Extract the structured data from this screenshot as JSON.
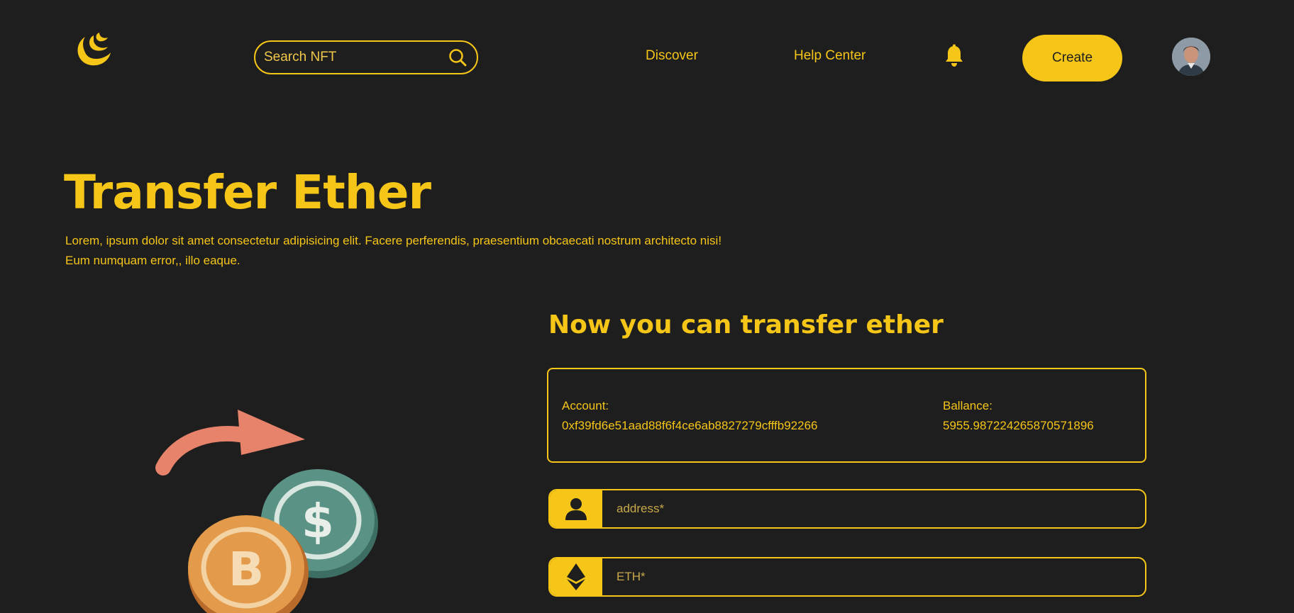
{
  "colors": {
    "background": "#1e1e1e",
    "accent": "#f5c518",
    "arrow": "#e6836a",
    "coin_green": "#4f8a7a",
    "coin_orange": "#e39a4a"
  },
  "header": {
    "logo_icon": "crescent-logo-icon",
    "search": {
      "placeholder": "Search NFT",
      "icon": "search-icon"
    },
    "nav": {
      "discover": "Discover",
      "help_center": "Help Center"
    },
    "notification_icon": "bell-icon",
    "create_label": "Create",
    "avatar_icon": "user-avatar"
  },
  "hero": {
    "title": "Transfer Ether",
    "description": "Lorem, ipsum dolor sit amet consectetur adipisicing elit. Facere perferendis, praesentium obcaecati nostrum architecto nisi! Eum numquam error,, illo eaque."
  },
  "transfer": {
    "heading": "Now you can transfer ether",
    "account_label": "Account:",
    "account_value": "0xf39fd6e51aad88f6f4ce6ab8827279cfffb92266",
    "balance_label": "Ballance:",
    "balance_value": "5955.987224265870571896",
    "address_placeholder": "address*",
    "address_icon": "user-icon",
    "eth_placeholder": "ETH*",
    "eth_icon": "ethereum-icon"
  },
  "illustration": {
    "icons": [
      "transfer-arrow-icon",
      "dollar-coin-icon",
      "bitcoin-coin-icon"
    ]
  }
}
